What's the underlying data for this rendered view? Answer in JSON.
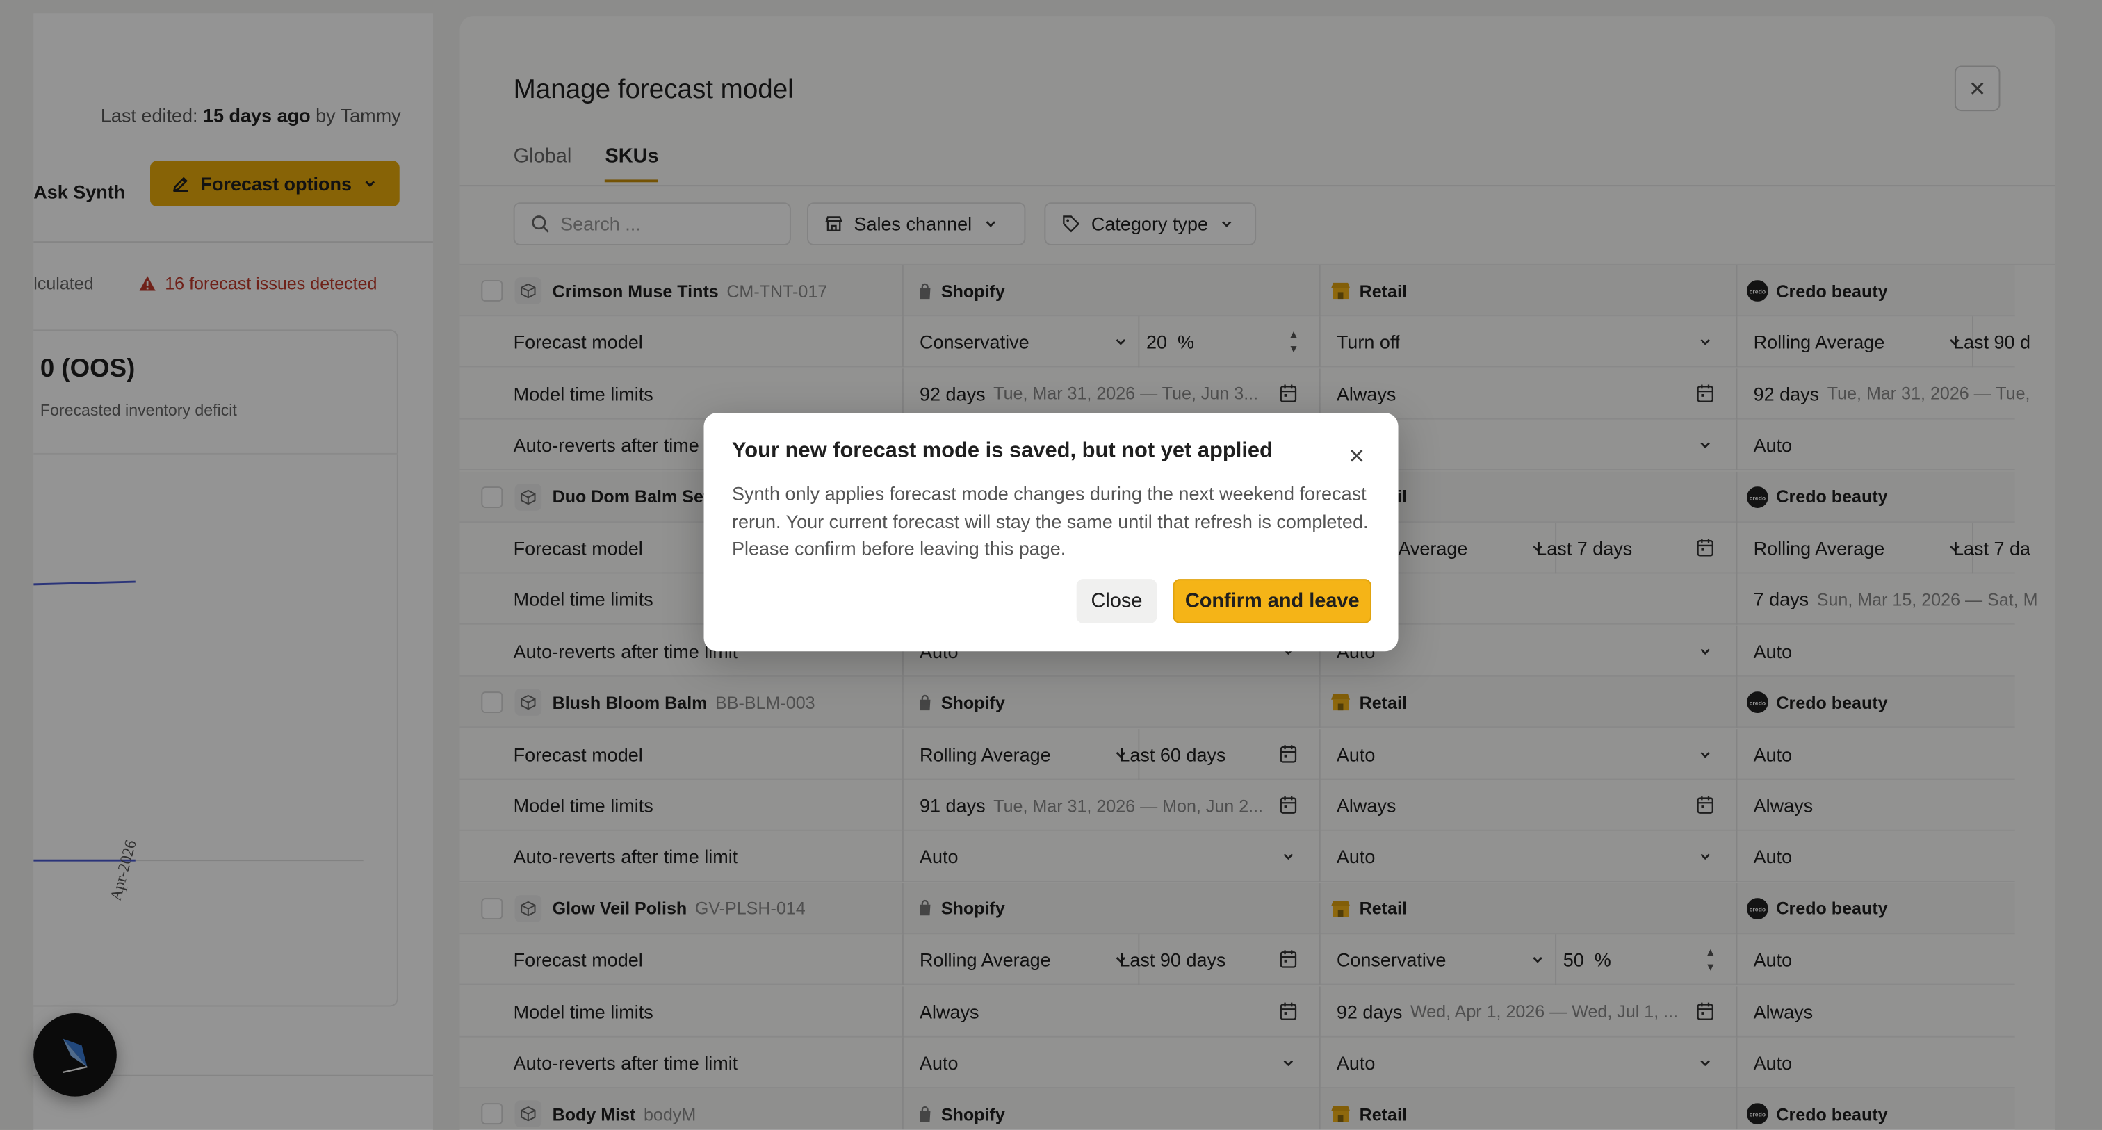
{
  "left": {
    "last_edited_prefix": "Last edited:",
    "last_edited_value": "15 days ago",
    "last_edited_by": "by Tammy",
    "ask_label": "Ask Synth",
    "forecast_options_label": "Forecast options",
    "calculated_label": "lculated",
    "issues_label": "16 forecast issues detected",
    "oos_value": "0 (OOS)",
    "oos_subtitle": "Forecasted inventory deficit",
    "chart_tick": "Apr-2026"
  },
  "panel": {
    "title": "Manage forecast model",
    "tabs": [
      {
        "label": "Global",
        "active": false
      },
      {
        "label": "SKUs",
        "active": true
      }
    ],
    "search_placeholder": "Search ...",
    "filters": {
      "sales_channel": "Sales channel",
      "category_type": "Category type"
    }
  },
  "table": {
    "skus": [
      {
        "name": "Crimson Muse Tints",
        "code": "CM-TNT-017",
        "channels": [
          "Shopify",
          "Retail",
          "Credo beauty"
        ],
        "forecast_model": {
          "c1": "Conservative",
          "c1b": "20",
          "c1b_unit": "%",
          "c2": "Turn off",
          "c3": "Rolling Average",
          "c3b": "Last 90 d"
        },
        "time_limits": {
          "c1_days": "92 days",
          "c1_range": "Tue, Mar 31, 2026 — Tue, Jun 3...",
          "c2": "Always",
          "c3_days": "92 days",
          "c3_range": "Tue, Mar 31, 2026 — Tue,"
        },
        "auto_reverts": {
          "c1": "",
          "c2": "",
          "c3": "Auto"
        }
      },
      {
        "name": "Duo Dom Balm Set",
        "code": "",
        "channels": [
          "",
          "Retail",
          "Credo beauty"
        ],
        "forecast_model": {
          "c1": "",
          "c2": "Rolling Average",
          "c2b": "Last 7 days",
          "c3": "Rolling Average",
          "c3b": "Last 7 da"
        },
        "time_limits": {
          "c1_days": "",
          "c1_range": "",
          "c3_days": "7 days",
          "c3_range": "Sun, Mar 15, 2026 — Sat, M"
        },
        "auto_reverts": {
          "c1": "Auto",
          "c2": "Auto",
          "c3": "Auto"
        }
      },
      {
        "name": "Blush Bloom Balm",
        "code": "BB-BLM-003",
        "channels": [
          "Shopify",
          "Retail",
          "Credo beauty"
        ],
        "forecast_model": {
          "c1": "Rolling Average",
          "c1b": "Last 60 days",
          "c2": "Auto",
          "c3": "Auto"
        },
        "time_limits": {
          "c1_days": "91 days",
          "c1_range": "Tue, Mar 31, 2026 — Mon, Jun 2...",
          "c2": "Always",
          "c3": "Always"
        },
        "auto_reverts": {
          "c1": "Auto",
          "c2": "Auto",
          "c3": "Auto"
        }
      },
      {
        "name": "Glow Veil Polish",
        "code": "GV-PLSH-014",
        "channels": [
          "Shopify",
          "Retail",
          "Credo beauty"
        ],
        "forecast_model": {
          "c1": "Rolling Average",
          "c1b": "Last 90 days",
          "c2": "Conservative",
          "c2b": "50",
          "c2b_unit": "%",
          "c3": "Auto"
        },
        "time_limits": {
          "c1": "Always",
          "c2_days": "92 days",
          "c2_range": "Wed, Apr 1, 2026 — Wed, Jul 1, ...",
          "c3": "Always"
        },
        "auto_reverts": {
          "c1": "Auto",
          "c2": "Auto",
          "c3": "Auto"
        }
      },
      {
        "name": "Body Mist",
        "code": "bodyM",
        "channels": [
          "Shopify",
          "Retail",
          "Credo beauty"
        ]
      }
    ],
    "row_labels": {
      "forecast_model": "Forecast model",
      "time_limits": "Model time limits",
      "auto_reverts": "Auto-reverts after time limit"
    }
  },
  "dialog": {
    "title": "Your new forecast mode is saved, but not yet applied",
    "body": "Synth only applies forecast mode changes during the next weekend forecast rerun. Your current forecast will stay the same until that refresh is completed. Please confirm before leaving this page.",
    "close_label": "Close",
    "confirm_label": "Confirm and leave"
  },
  "colors": {
    "accent": "#f5b417",
    "accent_dark": "#e8ab0c",
    "danger": "#c0392b",
    "chart_line": "#4a5bd1"
  }
}
